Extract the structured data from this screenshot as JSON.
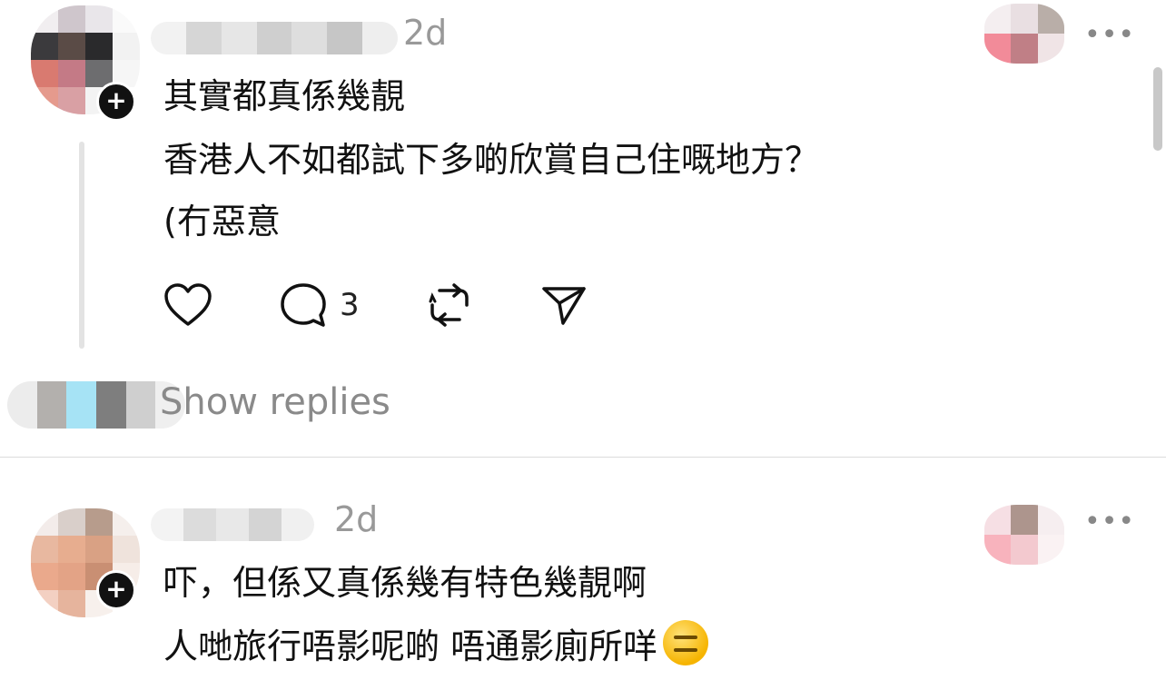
{
  "comments": [
    {
      "time": "2d",
      "lines": [
        "其實都真係幾靚",
        "香港人不如都試下多啲欣賞自己住嘅地方？",
        "(冇惡意"
      ],
      "actions": {
        "reply_count": "3"
      },
      "show_replies": "Show replies"
    },
    {
      "time": "2d",
      "lines": [
        "吓，但係又真係幾有特色幾靚啊",
        "人哋旅行唔影呢啲 唔通影廁所咩"
      ],
      "emoji": "expressionless-face-emoji"
    }
  ],
  "more_label": "•••",
  "plus_label": "+",
  "icons": {
    "like": "heart-icon",
    "comment": "comment-bubble-icon",
    "repost": "repost-icon",
    "share": "send-icon",
    "more": "more-dots-icon",
    "follow": "plus-badge-icon"
  },
  "colors": {
    "text": "#111111",
    "muted": "#999999",
    "divider": "#dcdcdc",
    "thread_line": "#e3e3e3"
  }
}
